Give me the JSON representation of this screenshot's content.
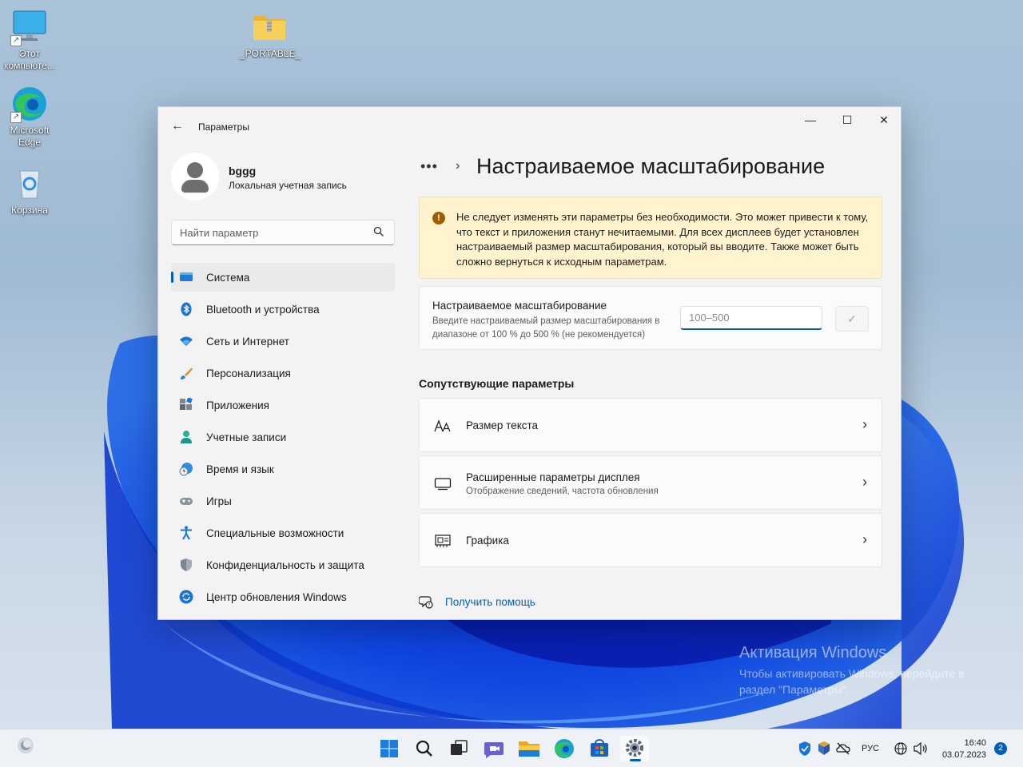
{
  "desktop": {
    "icons": [
      {
        "label": "Этот компьюте...",
        "icon": "monitor-icon"
      },
      {
        "label": "_PORTABLE_",
        "icon": "zip-folder-icon"
      },
      {
        "label": "Microsoft Edge",
        "icon": "edge-icon"
      },
      {
        "label": "Корзина",
        "icon": "recycle-bin-icon"
      }
    ]
  },
  "window": {
    "app_title": "Параметры",
    "controls": {
      "minimize": "—",
      "maximize": "☐",
      "close": "✕"
    }
  },
  "profile": {
    "name": "bggg",
    "account_type": "Локальная учетная запись"
  },
  "search": {
    "placeholder": "Найти параметр"
  },
  "sidebar": {
    "items": [
      {
        "label": "Система",
        "icon": "system-icon",
        "active": true
      },
      {
        "label": "Bluetooth и устройства",
        "icon": "bluetooth-icon"
      },
      {
        "label": "Сеть и Интернет",
        "icon": "wifi-icon"
      },
      {
        "label": "Персонализация",
        "icon": "brush-icon"
      },
      {
        "label": "Приложения",
        "icon": "apps-icon"
      },
      {
        "label": "Учетные записи",
        "icon": "accounts-icon"
      },
      {
        "label": "Время и язык",
        "icon": "globe-clock-icon"
      },
      {
        "label": "Игры",
        "icon": "gamepad-icon"
      },
      {
        "label": "Специальные возможности",
        "icon": "accessibility-icon"
      },
      {
        "label": "Конфиденциальность и защита",
        "icon": "shield-icon"
      },
      {
        "label": "Центр обновления Windows",
        "icon": "update-icon"
      }
    ]
  },
  "main": {
    "breadcrumb_more": "•••",
    "breadcrumb_sep": "›",
    "title": "Настраиваемое масштабирование",
    "warning": {
      "icon": "!",
      "text": "Не следует изменять эти параметры без необходимости. Это может привести к тому, что текст и приложения станут нечитаемыми. Для всех дисплеев будет установлен настраиваемый размер масштабирования, который вы вводите. Также может быть сложно вернуться к исходным параметрам."
    },
    "custom_scaling": {
      "title": "Настраиваемое масштабирование",
      "description": "Введите настраиваемый размер масштабирования в диапазоне от 100 % до 500 % (не рекомендуется)",
      "input_value": "",
      "input_placeholder": "100–500",
      "apply_glyph": "✓"
    },
    "related": {
      "heading": "Сопутствующие параметры",
      "items": [
        {
          "title": "Размер текста",
          "subtitle": "",
          "icon": "text-size-icon"
        },
        {
          "title": "Расширенные параметры дисплея",
          "subtitle": "Отображение сведений, частота обновления",
          "icon": "display-icon"
        },
        {
          "title": "Графика",
          "subtitle": "",
          "icon": "graphics-icon"
        }
      ]
    },
    "help_link": "Получить помощь"
  },
  "activation": {
    "title": "Активация Windows",
    "subtitle": "Чтобы активировать Windows, перейдите в раздел \"Параметры\"."
  },
  "taskbar": {
    "language": "РУС",
    "time": "16:40",
    "date": "03.07.2023",
    "notifications": "2"
  },
  "colors": {
    "accent": "#005fb8",
    "warning_bg": "#fff4ce",
    "warning_icon": "#9d5d00"
  }
}
